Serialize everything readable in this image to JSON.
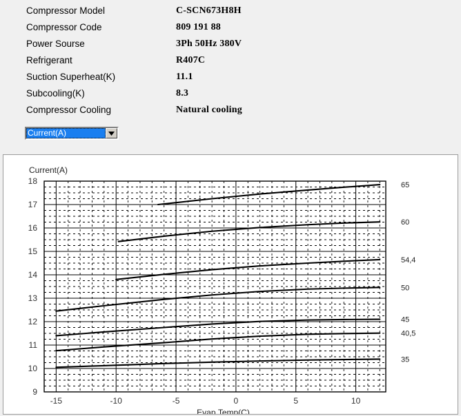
{
  "spec": {
    "rows": [
      {
        "label": "Compressor  Model",
        "value": "C-SCN673H8H"
      },
      {
        "label": "Compressor Code",
        "value": "809 191 88"
      },
      {
        "label": "Power Sourse",
        "value": "3Ph  50Hz  380V"
      },
      {
        "label": "Refrigerant",
        "value": "R407C"
      },
      {
        "label": "Suction Superheat(K)",
        "value": "11.1"
      },
      {
        "label": "Subcooling(K)",
        "value": "8.3"
      },
      {
        "label": "Compressor Cooling",
        "value": "Natural cooling"
      }
    ]
  },
  "chart_select": {
    "selected": "Current(A)",
    "arrow_icon": "chevron-down-icon"
  },
  "colors": {
    "page_background": "#f0f0f0",
    "panel_background": "#ffffff",
    "panel_border": "#9a9a9a",
    "select_highlight": "#1a7ff0",
    "axis": "#000000",
    "grid_major": "#000000",
    "grid_minor": "#000000",
    "curve": "#000000"
  },
  "chart_data": {
    "type": "line",
    "title": "",
    "subtitle": "",
    "xlabel": "Evap.Temp(C)",
    "ylabel": "Current(A)",
    "xlim": [
      -16,
      12.5
    ],
    "ylim": [
      9,
      18
    ],
    "xticks": [
      -15,
      -10,
      -5,
      0,
      5,
      10
    ],
    "yticks": [
      9,
      10,
      11,
      12,
      13,
      14,
      15,
      16,
      17,
      18
    ],
    "x_minor_step": 1,
    "y_minor_step": 0.25,
    "grid": true,
    "legend": "right-of-plot-endpoint-labels",
    "legend_title": "",
    "series": [
      {
        "name": "65",
        "label": "65",
        "x": [
          -6.5,
          -2,
          2,
          6,
          9,
          12
        ],
        "y": [
          17.0,
          17.25,
          17.45,
          17.62,
          17.74,
          17.85
        ]
      },
      {
        "name": "60",
        "label": "60",
        "x": [
          -9.8,
          -6,
          -2,
          2,
          6,
          9,
          12
        ],
        "y": [
          15.42,
          15.65,
          15.86,
          16.02,
          16.14,
          16.21,
          16.26
        ]
      },
      {
        "name": "54,4",
        "label": "54,4",
        "x": [
          -10,
          -6,
          -2,
          2,
          6,
          9,
          12
        ],
        "y": [
          13.8,
          14.02,
          14.22,
          14.38,
          14.5,
          14.58,
          14.65
        ]
      },
      {
        "name": "50",
        "label": "50",
        "x": [
          -15,
          -11,
          -6,
          -2,
          2,
          6,
          9,
          12
        ],
        "y": [
          12.45,
          12.68,
          12.95,
          13.14,
          13.29,
          13.39,
          13.43,
          13.46
        ]
      },
      {
        "name": "45",
        "label": "45",
        "x": [
          -15,
          -11,
          -6,
          -2,
          2,
          6,
          9,
          12
        ],
        "y": [
          11.4,
          11.56,
          11.75,
          11.9,
          12.01,
          12.07,
          12.09,
          12.1
        ]
      },
      {
        "name": "40,5",
        "label": "40,5",
        "x": [
          -15,
          -11,
          -6,
          -2,
          2,
          6,
          9,
          12
        ],
        "y": [
          10.76,
          10.92,
          11.1,
          11.26,
          11.38,
          11.46,
          11.49,
          11.51
        ]
      },
      {
        "name": "35",
        "label": "35",
        "x": [
          -15,
          -11,
          -6,
          -2,
          2,
          6,
          9,
          12
        ],
        "y": [
          10.05,
          10.12,
          10.21,
          10.27,
          10.32,
          10.36,
          10.38,
          10.4
        ]
      }
    ]
  }
}
